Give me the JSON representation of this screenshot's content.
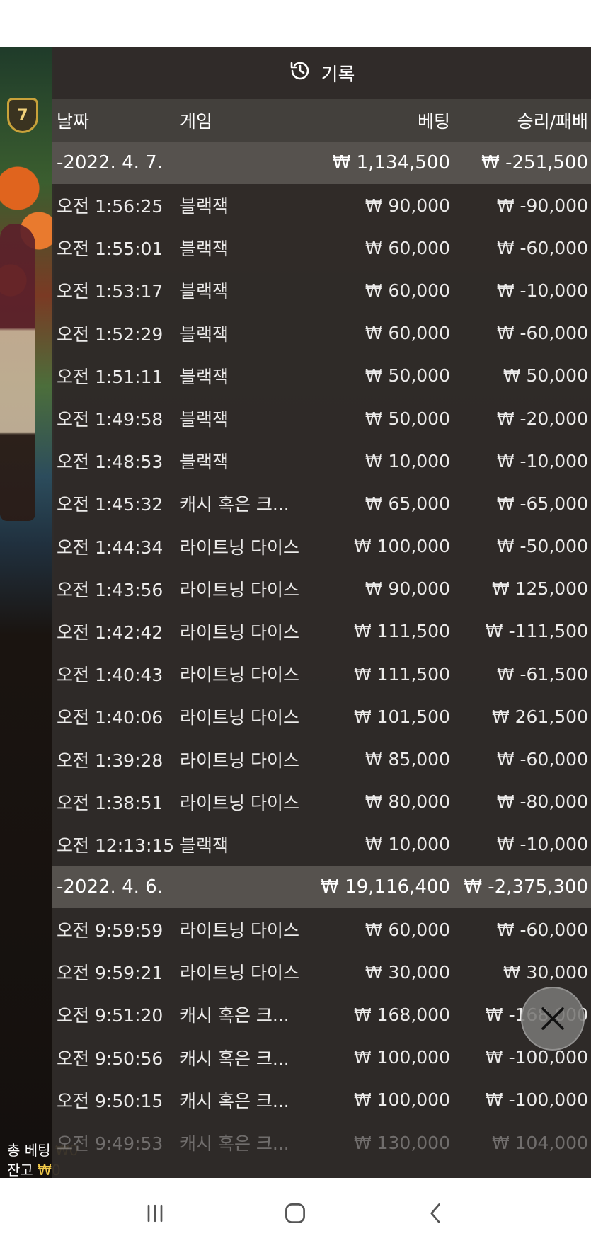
{
  "level_badge": "7",
  "panel": {
    "title": "기록",
    "columns": {
      "date": "날짜",
      "game": "게임",
      "bet": "베팅",
      "result": "승리/패배"
    }
  },
  "groups": [
    {
      "date": "-2022. 4. 7.",
      "bet": "₩ 1,134,500",
      "result": "₩ -251,500",
      "rows": [
        {
          "time": "오전 1:56:25",
          "game": "블랙잭",
          "bet": "₩ 90,000",
          "result": "₩ -90,000"
        },
        {
          "time": "오전 1:55:01",
          "game": "블랙잭",
          "bet": "₩ 60,000",
          "result": "₩ -60,000"
        },
        {
          "time": "오전 1:53:17",
          "game": "블랙잭",
          "bet": "₩ 60,000",
          "result": "₩ -10,000"
        },
        {
          "time": "오전 1:52:29",
          "game": "블랙잭",
          "bet": "₩ 60,000",
          "result": "₩ -60,000"
        },
        {
          "time": "오전 1:51:11",
          "game": "블랙잭",
          "bet": "₩ 50,000",
          "result": "₩ 50,000"
        },
        {
          "time": "오전 1:49:58",
          "game": "블랙잭",
          "bet": "₩ 50,000",
          "result": "₩ -20,000"
        },
        {
          "time": "오전 1:48:53",
          "game": "블랙잭",
          "bet": "₩ 10,000",
          "result": "₩ -10,000"
        },
        {
          "time": "오전 1:45:32",
          "game": "캐시 혹은 크...",
          "bet": "₩ 65,000",
          "result": "₩ -65,000"
        },
        {
          "time": "오전 1:44:34",
          "game": "라이트닝 다이스",
          "bet": "₩ 100,000",
          "result": "₩ -50,000"
        },
        {
          "time": "오전 1:43:56",
          "game": "라이트닝 다이스",
          "bet": "₩ 90,000",
          "result": "₩ 125,000"
        },
        {
          "time": "오전 1:42:42",
          "game": "라이트닝 다이스",
          "bet": "₩ 111,500",
          "result": "₩ -111,500"
        },
        {
          "time": "오전 1:40:43",
          "game": "라이트닝 다이스",
          "bet": "₩ 111,500",
          "result": "₩ -61,500"
        },
        {
          "time": "오전 1:40:06",
          "game": "라이트닝 다이스",
          "bet": "₩ 101,500",
          "result": "₩ 261,500"
        },
        {
          "time": "오전 1:39:28",
          "game": "라이트닝 다이스",
          "bet": "₩ 85,000",
          "result": "₩ -60,000"
        },
        {
          "time": "오전 1:38:51",
          "game": "라이트닝 다이스",
          "bet": "₩ 80,000",
          "result": "₩ -80,000"
        },
        {
          "time": "오전 12:13:15",
          "game": "블랙잭",
          "bet": "₩ 10,000",
          "result": "₩ -10,000"
        }
      ]
    },
    {
      "date": "-2022. 4. 6.",
      "bet": "₩ 19,116,400",
      "result": "₩ -2,375,300",
      "rows": [
        {
          "time": "오전 9:59:59",
          "game": "라이트닝 다이스",
          "bet": "₩ 60,000",
          "result": "₩ -60,000"
        },
        {
          "time": "오전 9:59:21",
          "game": "라이트닝 다이스",
          "bet": "₩ 30,000",
          "result": "₩ 30,000"
        },
        {
          "time": "오전 9:51:20",
          "game": "캐시 혹은 크...",
          "bet": "₩ 168,000",
          "result": "₩ -168,000"
        },
        {
          "time": "오전 9:50:56",
          "game": "캐시 혹은 크...",
          "bet": "₩ 100,000",
          "result": "₩ -100,000"
        },
        {
          "time": "오전 9:50:15",
          "game": "캐시 혹은 크...",
          "bet": "₩ 100,000",
          "result": "₩ -100,000"
        },
        {
          "time": "오전 9:49:53",
          "game": "캐시 혹은 크...",
          "bet": "₩ 130,000",
          "result": "₩ 104,000"
        }
      ]
    }
  ],
  "bottom_info": {
    "total_bet_label": "총 베팅",
    "total_bet_value": "₩0",
    "balance_label": "잔고",
    "balance_value": "₩0"
  },
  "icons": {
    "history": "history-clock-icon",
    "close": "close-icon",
    "nav_recent": "recent-apps-icon",
    "nav_home": "home-icon",
    "nav_back": "back-icon"
  }
}
